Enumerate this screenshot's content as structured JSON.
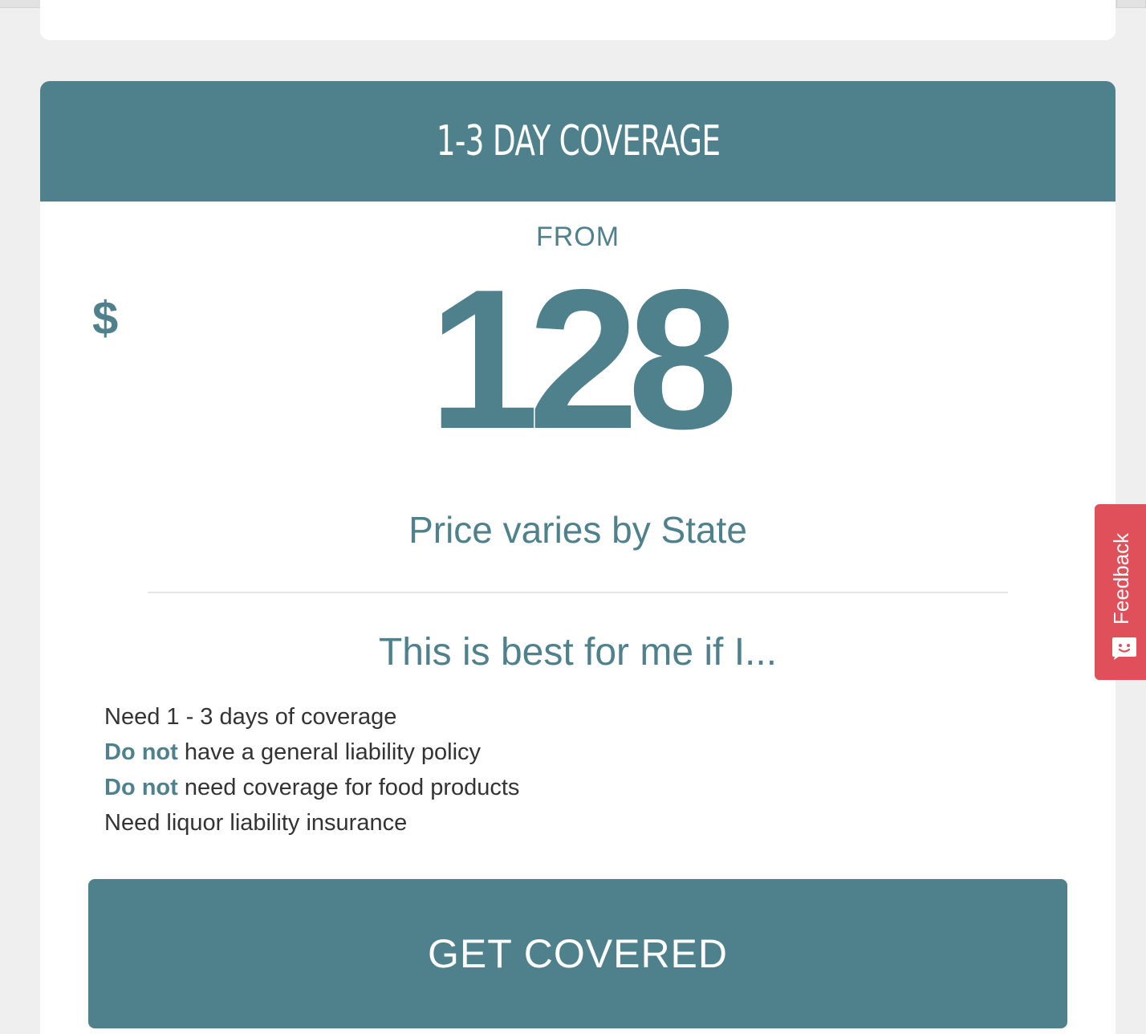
{
  "plan": {
    "title": "1-3 DAY COVERAGE",
    "from_label": "FROM",
    "currency_symbol": "$",
    "price": "128",
    "price_note": "Price varies by State",
    "best_for_heading": "This is best for me if I...",
    "criteria": [
      {
        "emphasis": "",
        "text": "Need 1 - 3 days of coverage"
      },
      {
        "emphasis": "Do not",
        "text": " have a general liability policy"
      },
      {
        "emphasis": "Do not",
        "text": " need coverage for food products"
      },
      {
        "emphasis": "",
        "text": "Need liquor liability insurance"
      }
    ],
    "cta_label": "GET COVERED"
  },
  "feedback": {
    "label": "Feedback",
    "icon": "smiley-chat-icon"
  },
  "colors": {
    "brand_teal": "#4f818c",
    "feedback_red": "#e0505a",
    "background": "#efefef",
    "card": "#ffffff"
  }
}
